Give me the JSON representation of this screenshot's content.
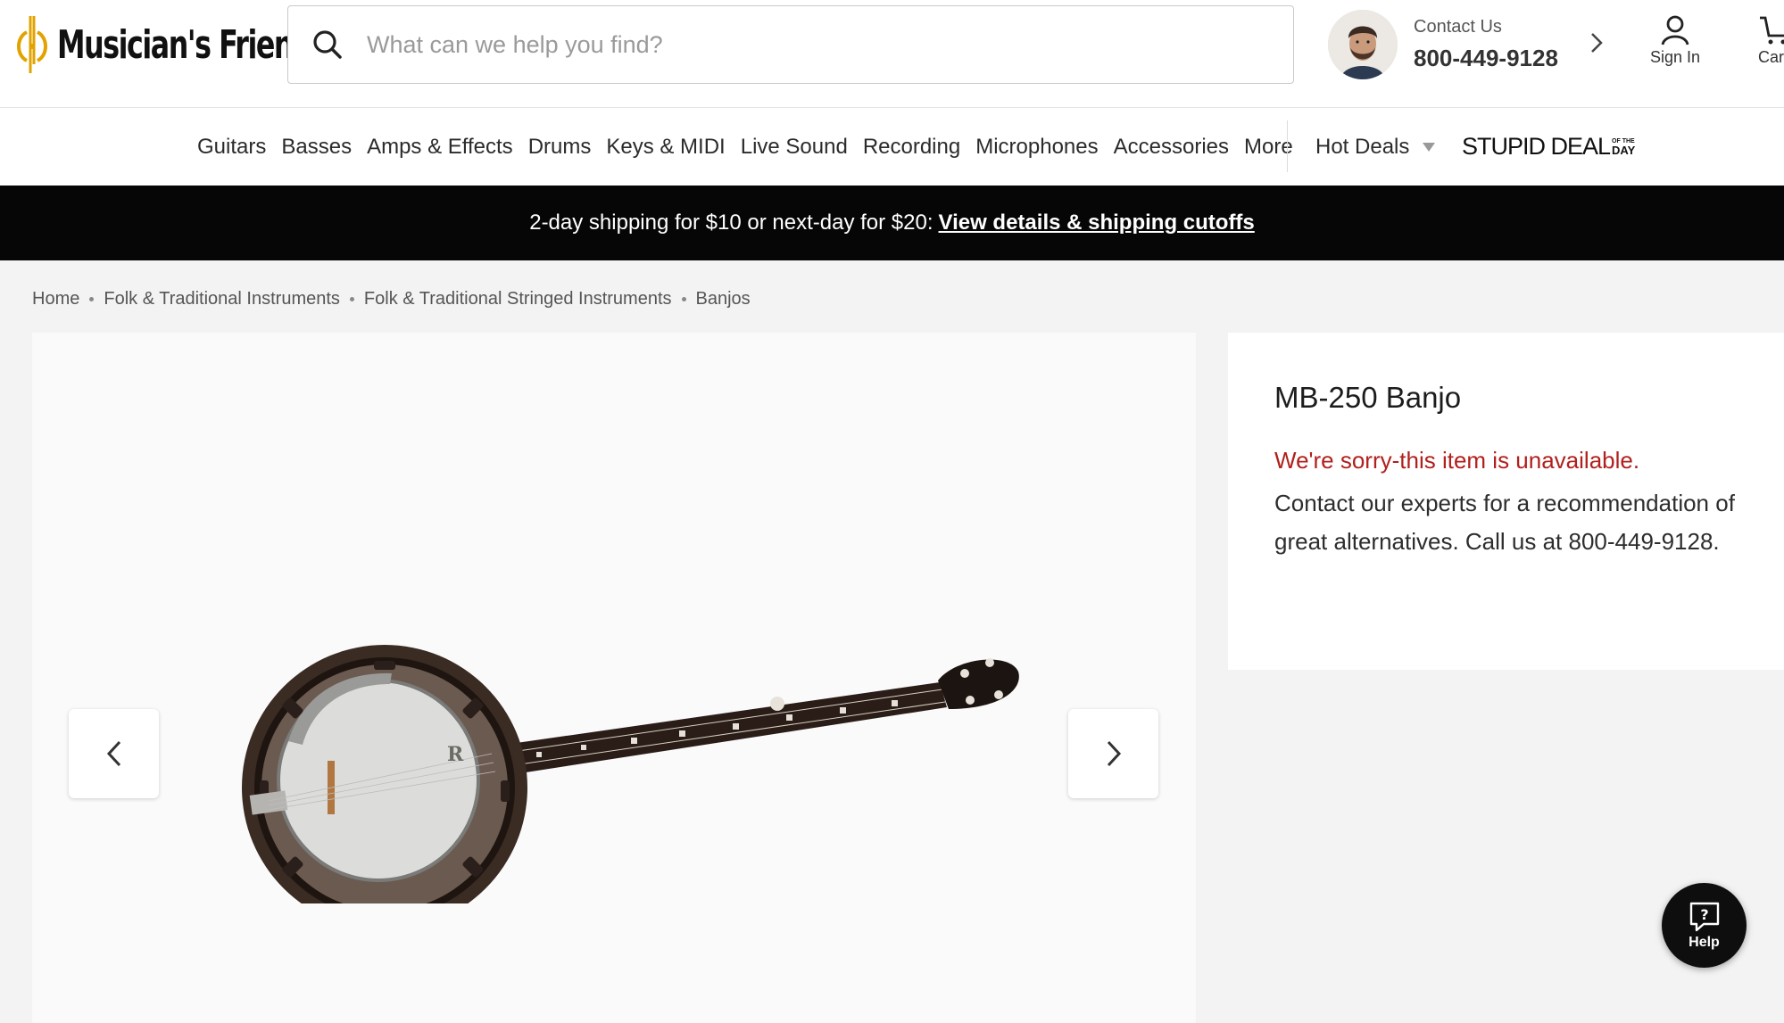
{
  "header": {
    "logo_text": "Musician's Friend",
    "search_placeholder": "What can we help you find?",
    "contact_label": "Contact Us",
    "contact_phone": "800-449-9128",
    "signin_label": "Sign In",
    "cart_label": "Cart"
  },
  "nav": {
    "items": [
      "Guitars",
      "Basses",
      "Amps & Effects",
      "Drums",
      "Keys & MIDI",
      "Live Sound",
      "Recording",
      "Microphones",
      "Accessories",
      "More"
    ],
    "hot_deals": "Hot Deals",
    "stupid_deal": "STUPID DEAL",
    "stupid_deal_of_the": "OF THE",
    "stupid_deal_day": "DAY"
  },
  "banner": {
    "text": "2-day shipping for $10 or next-day for $20:",
    "link": "View details & shipping cutoffs"
  },
  "breadcrumb": [
    "Home",
    "Folk & Traditional Instruments",
    "Folk & Traditional Stringed Instruments",
    "Banjos"
  ],
  "product": {
    "title": "MB-250 Banjo",
    "unavailable": "We're sorry-this item is unavailable.",
    "message": "Contact our experts for a recommendation of great alternatives. Call us at 800-449-9128."
  },
  "help": {
    "label": "Help"
  },
  "colors": {
    "brand_gold": "#e2a300",
    "alert_red": "#b1201d",
    "banner_bg": "#060606"
  }
}
